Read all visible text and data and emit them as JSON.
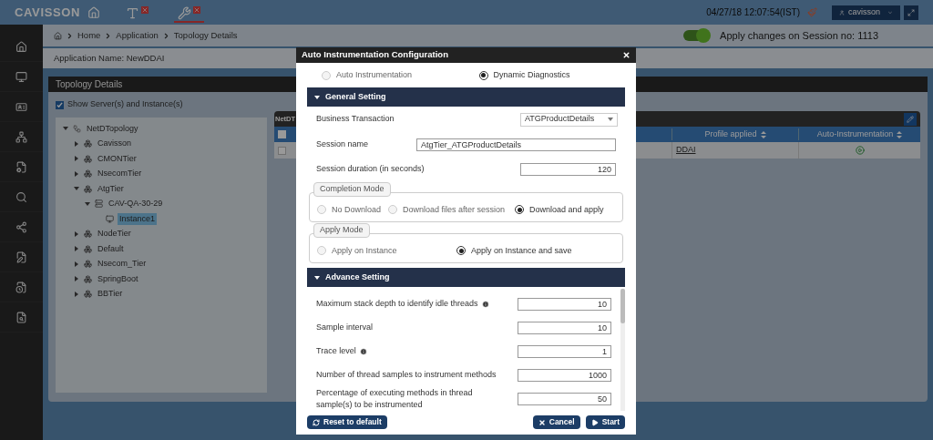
{
  "top_bar": {
    "logo": "CAVISSON",
    "tabs": [
      {
        "kind": "text-tool",
        "selected": false
      },
      {
        "kind": "tools",
        "selected": true
      }
    ],
    "datetime": "04/27/18 12:07:54(IST)",
    "user": "cavisson"
  },
  "sidebar": {
    "items": [
      {
        "kind": "home"
      },
      {
        "kind": "monitor"
      },
      {
        "kind": "id-card"
      },
      {
        "kind": "network"
      },
      {
        "kind": "file-gear"
      },
      {
        "kind": "search"
      },
      {
        "kind": "share"
      },
      {
        "kind": "file-edit"
      },
      {
        "kind": "file-clock"
      },
      {
        "kind": "file-search"
      }
    ]
  },
  "breadcrumb": [
    "Home",
    "Application",
    "Topology Details"
  ],
  "session_toggle": {
    "on": true,
    "label": "Apply changes on Session no: 1113"
  },
  "application_name": "Application Name: NewDDAI",
  "topology": {
    "title": "Topology Details",
    "show_servers": {
      "label": "Show Server(s) and Instance(s)",
      "checked": true
    },
    "tree": [
      {
        "label": "NetDTopology",
        "kind": "root",
        "expanded": true,
        "selected": false,
        "children": [
          {
            "label": "Cavisson",
            "kind": "tier",
            "expanded": false,
            "selected": false
          },
          {
            "label": "CMONTier",
            "kind": "tier",
            "expanded": false,
            "selected": false
          },
          {
            "label": "NsecomTier",
            "kind": "tier",
            "expanded": false,
            "selected": false
          },
          {
            "label": "AtgTier",
            "kind": "tier",
            "expanded": true,
            "selected": false,
            "children": [
              {
                "label": "CAV-QA-30-29",
                "kind": "server",
                "expanded": true,
                "selected": false,
                "children": [
                  {
                    "label": "Instance1",
                    "kind": "instance",
                    "selected": true
                  }
                ]
              }
            ]
          },
          {
            "label": "NodeTier",
            "kind": "tier",
            "expanded": false,
            "selected": false
          },
          {
            "label": "Default",
            "kind": "tier",
            "expanded": false,
            "selected": false
          },
          {
            "label": "Nsecom_Tier",
            "kind": "tier",
            "expanded": false,
            "selected": false
          },
          {
            "label": "SpringBoot",
            "kind": "tier",
            "expanded": false,
            "selected": false
          },
          {
            "label": "BBTier",
            "kind": "tier",
            "expanded": false,
            "selected": false
          }
        ]
      }
    ]
  },
  "table": {
    "title": "NetDT",
    "header_checked": false,
    "columns": [
      "Profile applied",
      "Auto-Instrumentation"
    ],
    "rows": [
      {
        "checked": false,
        "profile": "DDAI"
      }
    ]
  },
  "dialog": {
    "title": "Auto Instrumentation Configuration",
    "modes": [
      {
        "label": "Auto Instrumentation",
        "selected": false
      },
      {
        "label": "Dynamic Diagnostics",
        "selected": true
      }
    ],
    "general": {
      "title": "General Setting",
      "expanded": true,
      "business_transaction": {
        "label": "Business Transaction",
        "value": "ATGProductDetails"
      },
      "session_name": {
        "label": "Session name",
        "value": "AtgTier_ATGProductDetails"
      },
      "session_duration": {
        "label": "Session duration (in seconds)",
        "value": "120"
      },
      "completion_mode": {
        "legend": "Completion Mode",
        "options": [
          {
            "label": "No Download",
            "selected": false
          },
          {
            "label": "Download files after session",
            "selected": false
          },
          {
            "label": "Download and apply",
            "selected": true
          }
        ]
      },
      "apply_mode": {
        "legend": "Apply Mode",
        "options": [
          {
            "label": "Apply on Instance",
            "selected": false
          },
          {
            "label": "Apply on Instance and save",
            "selected": true
          }
        ]
      }
    },
    "advance": {
      "title": "Advance Setting",
      "expanded": true,
      "fields": [
        {
          "label": "Maximum stack depth to identify idle threads",
          "info": true,
          "value": "10"
        },
        {
          "label": "Sample interval",
          "info": false,
          "value": "10"
        },
        {
          "label": "Trace level",
          "info": true,
          "value": "1"
        },
        {
          "label": "Number of thread samples to instrument methods",
          "info": false,
          "value": "1000"
        },
        {
          "label": "Percentage of executing methods in thread sample(s) to be instrumented",
          "info": false,
          "value": "50"
        }
      ]
    },
    "buttons": {
      "reset": "Reset to default",
      "cancel": "Cancel",
      "start": "Start"
    }
  }
}
